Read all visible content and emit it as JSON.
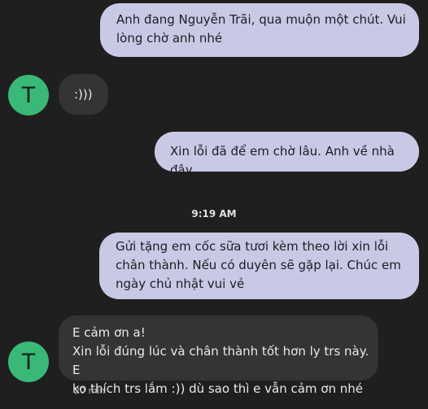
{
  "messages": [
    {
      "direction": "outgoing",
      "text": "Anh đang Nguyễn Trãi, qua muộn một chút. Vui\nlòng chờ anh nhé"
    },
    {
      "direction": "incoming",
      "sender_initial": "T",
      "text": ":)))"
    },
    {
      "direction": "outgoing",
      "text": "Xin lỗi đã để em chờ lâu. Anh về nhà đây"
    },
    {
      "direction": "outgoing",
      "text": "Gửi tặng em cốc sữa tươi kèm theo lời xin lỗi\nchân thành. Nếu có duyên sẽ gặp lại. Chúc em\nngày chủ nhật vui vẻ"
    },
    {
      "direction": "incoming",
      "sender_initial": "T",
      "text": "E cảm ơn a!\nXin lỗi đúng lúc và chân thành tốt hơn ly trs này. E\nko thích trs lắm :)) dù sao thì e vẫn cảm ơn nhé",
      "time": "20 min"
    }
  ],
  "timestamp": "9:19 AM",
  "colors": {
    "background": "#1f1f1f",
    "outgoing_bubble": "#c8cae5",
    "incoming_bubble": "#343434",
    "avatar": "#3ab878"
  }
}
